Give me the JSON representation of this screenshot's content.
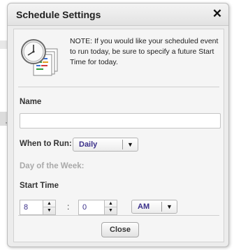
{
  "dialog": {
    "title": "Schedule Settings",
    "close_glyph": "✕",
    "note": "NOTE: If you would like your scheduled event to run today, be sure to specify a future Start Time for today."
  },
  "form": {
    "name_label": "Name",
    "name_value": "",
    "when_label": "When to Run:",
    "when_value": "Daily",
    "dow_label": "Day of the Week:",
    "start_label": "Start Time",
    "hour_value": "8",
    "time_separator": ":",
    "minute_value": "0",
    "ampm_value": "AM"
  },
  "buttons": {
    "close_label": "Close"
  },
  "background": {
    "partial_char": "T"
  },
  "icons": {
    "note": "clock-documents-icon",
    "dropdown": "caret-down-icon",
    "spin_up": "caret-up-icon",
    "spin_down": "caret-down-icon"
  },
  "colors": {
    "value_text": "#3a2f8a",
    "disabled_label": "#a9a9a9"
  }
}
